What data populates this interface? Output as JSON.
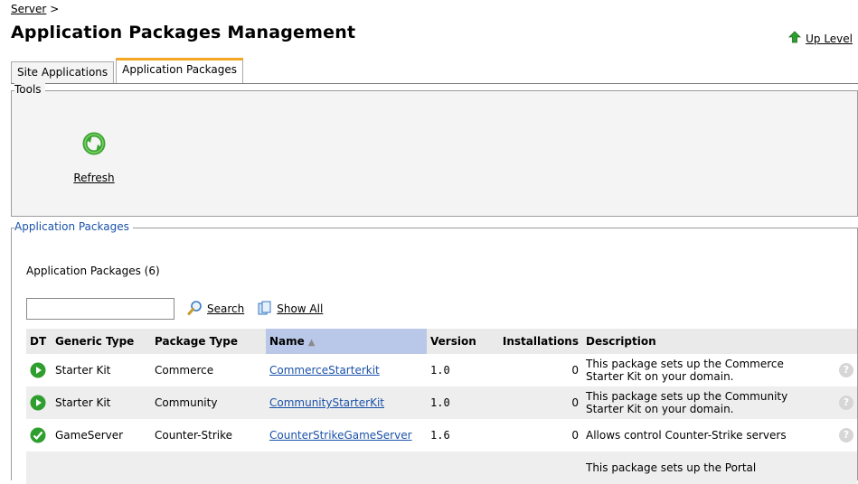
{
  "breadcrumb": {
    "server_label": "Server",
    "separator": ">"
  },
  "page": {
    "title": "Application Packages Management",
    "up_level_label": "Up Level"
  },
  "tabs": [
    {
      "label": "Site Applications",
      "active": false
    },
    {
      "label": "Application Packages",
      "active": true
    }
  ],
  "tools": {
    "legend": "Tools",
    "refresh_label": "Refresh"
  },
  "packages": {
    "legend": "Application Packages",
    "count_label": "Application Packages (6)",
    "search": {
      "value": "",
      "placeholder": ""
    },
    "search_label": "Search",
    "show_all_label": "Show All",
    "columns": [
      "DT",
      "Generic Type",
      "Package Type",
      "Name",
      "Version",
      "Installations",
      "Description"
    ],
    "sorted_column": "Name",
    "rows": [
      {
        "status": "play",
        "generic_type": "Starter Kit",
        "package_type": "Commerce",
        "name": "CommerceStarterkit",
        "version": "1.0",
        "installations": "0",
        "description": "This package sets up the Commerce Starter Kit on your domain."
      },
      {
        "status": "play",
        "generic_type": "Starter Kit",
        "package_type": "Community",
        "name": "CommunityStarterKit",
        "version": "1.0",
        "installations": "0",
        "description": "This package sets up the Community Starter Kit on your domain."
      },
      {
        "status": "check",
        "generic_type": "GameServer",
        "package_type": "Counter-Strike",
        "name": "CounterStrikeGameServer",
        "version": "1.6",
        "installations": "0",
        "description": "Allows control Counter-Strike servers"
      },
      {
        "status": "",
        "generic_type": "",
        "package_type": "",
        "name": "",
        "version": "",
        "installations": "",
        "description": "This package sets up the Portal"
      }
    ]
  },
  "colors": {
    "tab_accent": "#f5a623",
    "link": "#1a52a8",
    "status_green": "#2e9e2e",
    "sorted_header": "#b9c8e8"
  }
}
